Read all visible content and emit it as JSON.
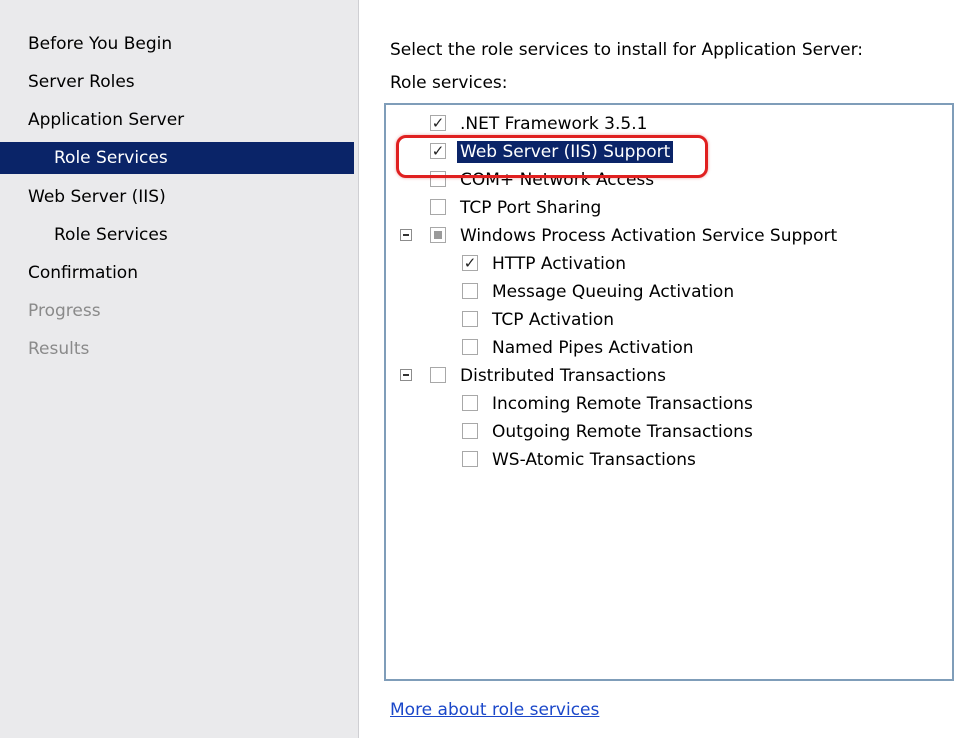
{
  "nav": {
    "items": [
      {
        "label": "Before You Begin",
        "state": "normal"
      },
      {
        "label": "Server Roles",
        "state": "normal"
      },
      {
        "label": "Application Server",
        "state": "normal"
      },
      {
        "label": "Role Services",
        "state": "active"
      },
      {
        "label": "Web Server (IIS)",
        "state": "normal"
      },
      {
        "label": "Role Services",
        "state": "normal"
      },
      {
        "label": "Confirmation",
        "state": "normal"
      },
      {
        "label": "Progress",
        "state": "disabled"
      },
      {
        "label": "Results",
        "state": "disabled"
      }
    ]
  },
  "content": {
    "instruction": "Select the role services to install for Application Server:",
    "list_label": "Role services:",
    "more_link": "More about role services"
  },
  "tree": {
    "items": [
      {
        "label": ".NET Framework 3.5.1",
        "checked": true
      },
      {
        "label": "Web Server (IIS) Support",
        "checked": true,
        "selected": true
      },
      {
        "label": "COM+ Network Access",
        "checked": false
      },
      {
        "label": "TCP Port Sharing",
        "checked": false
      },
      {
        "label": "Windows Process Activation Service Support",
        "checked": "partial",
        "expanded": true
      },
      {
        "label": "HTTP Activation",
        "checked": true
      },
      {
        "label": "Message Queuing Activation",
        "checked": false
      },
      {
        "label": "TCP Activation",
        "checked": false
      },
      {
        "label": "Named Pipes Activation",
        "checked": false
      },
      {
        "label": "Distributed Transactions",
        "checked": false,
        "expanded": true
      },
      {
        "label": "Incoming Remote Transactions",
        "checked": false
      },
      {
        "label": "Outgoing Remote Transactions",
        "checked": false
      },
      {
        "label": "WS-Atomic Transactions",
        "checked": false
      }
    ]
  },
  "colors": {
    "nav_background": "#eaeaec",
    "selection": "#0a2468",
    "annotation_ring": "#e02020",
    "link": "#1a47c9"
  }
}
